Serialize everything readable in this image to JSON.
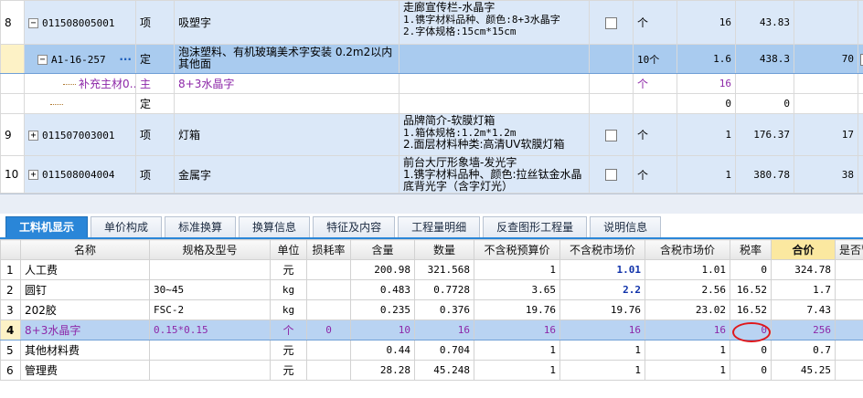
{
  "upper": {
    "rows": [
      {
        "seq": "8",
        "code": "011508005001",
        "type": "项",
        "name": "吸塑字",
        "feature": [
          "走廊宣传栏-水晶字",
          "1.镌字材料品种、颜色:8+3水晶字",
          "2.字体规格:15cm*15cm"
        ],
        "unit": "个",
        "qty": "16",
        "price": "43.83",
        "extra": ""
      },
      {
        "seq": "",
        "code": "A1-16-257",
        "type": "定",
        "name": "泡沫塑料、有机玻璃美术字安装 0.2m2以内 其他面",
        "unit": "10个",
        "qty": "1.6",
        "price": "438.3",
        "extra": "70"
      },
      {
        "seq": "",
        "code": "补充主材0…",
        "type": "主",
        "name": "8+3水晶字",
        "unit": "个",
        "qty": "16",
        "price": "",
        "extra": ""
      },
      {
        "seq": "",
        "code": "",
        "type": "定",
        "name": "",
        "unit": "",
        "qty": "0",
        "price": "0",
        "extra": ""
      },
      {
        "seq": "9",
        "code": "011507003001",
        "type": "项",
        "name": "灯箱",
        "feature": [
          "品牌简介-软膜灯箱",
          "1.箱体规格:1.2m*1.2m",
          "2.面层材料种类:高清UV软膜灯箱"
        ],
        "unit": "个",
        "qty": "1",
        "price": "176.37",
        "extra": "17"
      },
      {
        "seq": "10",
        "code": "011508004004",
        "type": "项",
        "name": "金属字",
        "feature": [
          "前台大厅形象墙-发光字",
          "1.镌字材料品种、颜色:拉丝钛金水晶",
          "底背光字（含字灯光）"
        ],
        "unit": "个",
        "qty": "1",
        "price": "380.78",
        "extra": "38"
      }
    ]
  },
  "tabs": [
    "工料机显示",
    "单价构成",
    "标准换算",
    "换算信息",
    "特征及内容",
    "工程量明细",
    "反查图形工程量",
    "说明信息"
  ],
  "lower": {
    "headers": [
      "",
      "名称",
      "规格及型号",
      "单位",
      "损耗率",
      "含量",
      "数量",
      "不含税预算价",
      "不含税市场价",
      "含税市场价",
      "税率",
      "合价",
      "是否暂"
    ],
    "rows": [
      {
        "seq": "1",
        "name": "人工费",
        "spec": "",
        "unit": "元",
        "loss": "",
        "content": "200.98",
        "qty": "321.568",
        "budget": "1",
        "market": "1.01",
        "market_tax": "1.01",
        "rate": "0",
        "total": "324.78"
      },
      {
        "seq": "2",
        "name": "圆钉",
        "spec": "30~45",
        "unit": "kg",
        "loss": "",
        "content": "0.483",
        "qty": "0.7728",
        "budget": "3.65",
        "market": "2.2",
        "market_tax": "2.56",
        "rate": "16.52",
        "total": "1.7"
      },
      {
        "seq": "3",
        "name": "202胶",
        "spec": "FSC-2",
        "unit": "kg",
        "loss": "",
        "content": "0.235",
        "qty": "0.376",
        "budget": "19.76",
        "market": "19.76",
        "market_tax": "23.02",
        "rate": "16.52",
        "total": "7.43"
      },
      {
        "seq": "4",
        "name": "8+3水晶字",
        "spec": "0.15*0.15",
        "unit": "个",
        "loss": "0",
        "content": "10",
        "qty": "16",
        "budget": "16",
        "market": "16",
        "market_tax": "16",
        "rate": "0",
        "total": "256"
      },
      {
        "seq": "5",
        "name": "其他材料费",
        "spec": "",
        "unit": "元",
        "loss": "",
        "content": "0.44",
        "qty": "0.704",
        "budget": "1",
        "market": "1",
        "market_tax": "1",
        "rate": "0",
        "total": "0.7"
      },
      {
        "seq": "6",
        "name": "管理费",
        "spec": "",
        "unit": "元",
        "loss": "",
        "content": "28.28",
        "qty": "45.248",
        "budget": "1",
        "market": "1",
        "market_tax": "1",
        "rate": "0",
        "total": "45.25"
      }
    ]
  },
  "colors": {
    "accent": "#2a86d8",
    "selected_row": "#b9d3f2",
    "highlight_circle": "#e0171b",
    "purple_text": "#8d27a8"
  }
}
